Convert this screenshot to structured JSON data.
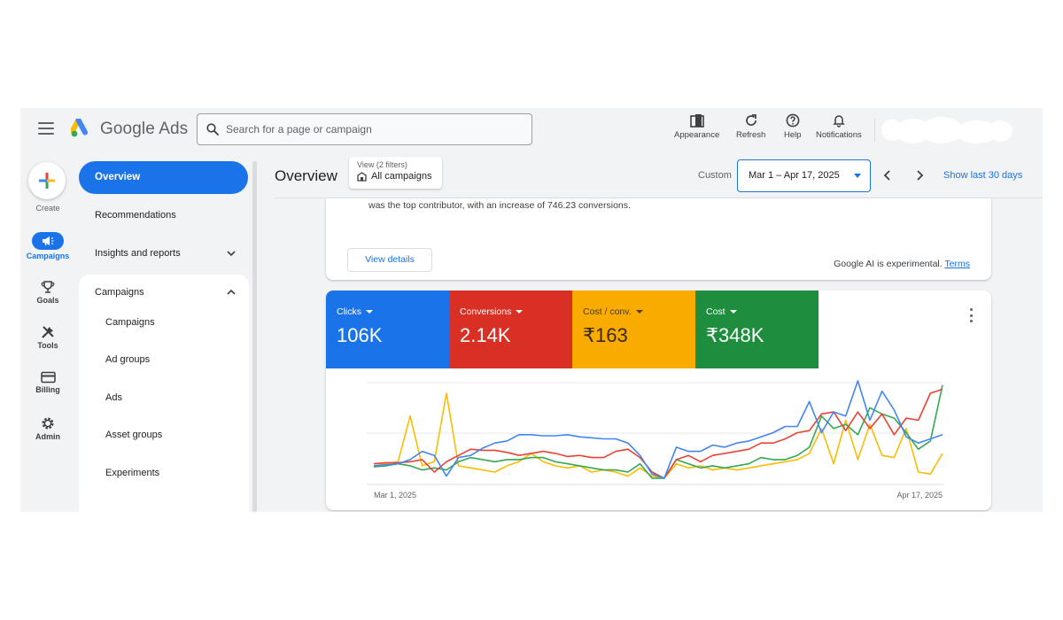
{
  "topbar": {
    "product_name": "Google Ads",
    "search_placeholder": "Search for a page or campaign",
    "tools": [
      {
        "label": "Appearance",
        "icon": "appearance-icon"
      },
      {
        "label": "Refresh",
        "icon": "refresh-icon"
      },
      {
        "label": "Help",
        "icon": "help-icon"
      },
      {
        "label": "Notifications",
        "icon": "bell-icon"
      }
    ]
  },
  "rail": {
    "create_label": "Create",
    "items": [
      {
        "label": "Campaigns",
        "icon": "megaphone-icon",
        "active": true
      },
      {
        "label": "Goals",
        "icon": "trophy-icon"
      },
      {
        "label": "Tools",
        "icon": "tools-icon"
      },
      {
        "label": "Billing",
        "icon": "card-icon"
      },
      {
        "label": "Admin",
        "icon": "gear-icon"
      }
    ]
  },
  "nav": {
    "overview": "Overview",
    "recommendations": "Recommendations",
    "insights": "Insights and reports",
    "campaigns_group": "Campaigns",
    "sub_items": [
      "Campaigns",
      "Ad groups",
      "Ads",
      "Asset groups",
      "Experiments"
    ]
  },
  "header": {
    "title": "Overview",
    "view_filter_small": "View (2 filters)",
    "view_filter_value": "All campaigns",
    "custom_label": "Custom",
    "date_range": "Mar 1 – Apr 17, 2025",
    "show_last": "Show last 30 days"
  },
  "ai_card": {
    "text": "was the top contributor, with an increase of 746.23 conversions.",
    "view_details": "View details",
    "note": "Google AI is experimental.",
    "terms": "Terms"
  },
  "metrics": [
    {
      "name": "Clicks",
      "value": "106K",
      "color": "#1a73e8"
    },
    {
      "name": "Conversions",
      "value": "2.14K",
      "color": "#d93025"
    },
    {
      "name": "Cost / conv.",
      "value": "₹163",
      "color": "#f9ab00"
    },
    {
      "name": "Cost",
      "value": "₹348K",
      "color": "#1e8e3e"
    }
  ],
  "chart_data": {
    "type": "line",
    "x_start_label": "Mar 1, 2025",
    "x_end_label": "Apr 17, 2025",
    "ylim": [
      0,
      100
    ],
    "series": [
      {
        "name": "Clicks",
        "color": "#4285f4",
        "values": [
          18,
          19,
          20,
          24,
          32,
          28,
          8,
          26,
          28,
          35,
          40,
          42,
          48,
          48,
          47,
          47,
          48,
          46,
          45,
          44,
          44,
          40,
          28,
          10,
          6,
          36,
          32,
          32,
          38,
          36,
          40,
          42,
          46,
          50,
          56,
          56,
          80,
          50,
          70,
          66,
          100,
          62,
          90,
          72,
          46,
          40,
          44,
          48
        ]
      },
      {
        "name": "Conversions",
        "color": "#ea4335",
        "values": [
          20,
          21,
          21,
          22,
          24,
          12,
          22,
          28,
          34,
          33,
          33,
          31,
          28,
          30,
          32,
          30,
          27,
          28,
          26,
          26,
          32,
          34,
          26,
          12,
          6,
          24,
          28,
          22,
          28,
          30,
          32,
          34,
          40,
          40,
          44,
          50,
          52,
          68,
          70,
          52,
          70,
          54,
          68,
          48,
          64,
          62,
          88,
          92
        ]
      },
      {
        "name": "Cost / conv.",
        "color": "#fbbc04",
        "values": [
          20,
          20,
          22,
          66,
          18,
          22,
          88,
          18,
          16,
          14,
          12,
          18,
          22,
          30,
          22,
          18,
          16,
          18,
          12,
          14,
          12,
          8,
          16,
          8,
          6,
          20,
          16,
          18,
          14,
          16,
          14,
          16,
          18,
          20,
          22,
          24,
          30,
          54,
          20,
          62,
          24,
          58,
          28,
          26,
          54,
          12,
          10,
          30
        ]
      },
      {
        "name": "Cost",
        "color": "#34a853",
        "values": [
          17,
          18,
          20,
          18,
          14,
          16,
          14,
          22,
          26,
          24,
          22,
          24,
          24,
          26,
          26,
          22,
          20,
          18,
          16,
          14,
          14,
          12,
          20,
          6,
          6,
          24,
          20,
          16,
          18,
          16,
          18,
          20,
          26,
          24,
          24,
          28,
          36,
          66,
          54,
          58,
          48,
          74,
          68,
          64,
          50,
          34,
          42,
          96
        ]
      }
    ]
  }
}
